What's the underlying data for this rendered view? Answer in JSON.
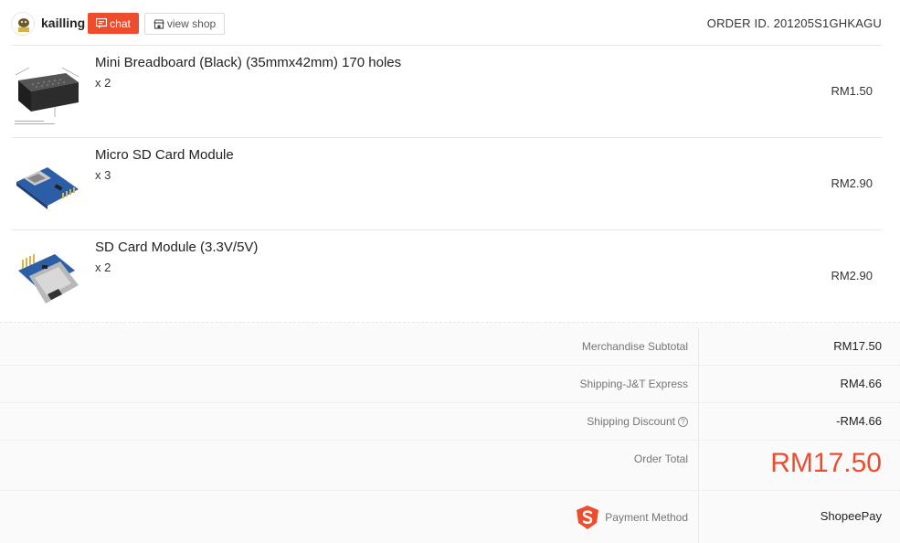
{
  "shop": {
    "name": "kailling",
    "chat_label": "chat",
    "view_shop_label": "view shop"
  },
  "order": {
    "id_label": "ORDER ID. 201205S1GHKAGU"
  },
  "items": [
    {
      "name": "Mini Breadboard (Black) (35mmx42mm) 170 holes",
      "qty": "x 2",
      "price": "RM1.50"
    },
    {
      "name": "Micro SD Card Module",
      "qty": "x 3",
      "price": "RM2.90"
    },
    {
      "name": "SD Card Module (3.3V/5V)",
      "qty": "x 2",
      "price": "RM2.90"
    }
  ],
  "summary": {
    "merchandise_subtotal_label": "Merchandise Subtotal",
    "merchandise_subtotal_value": "RM17.50",
    "shipping_label": "Shipping-J&T Express",
    "shipping_value": "RM4.66",
    "shipping_discount_label": "Shipping Discount",
    "shipping_discount_value": "-RM4.66",
    "order_total_label": "Order Total",
    "order_total_value": "RM17.50",
    "payment_method_label": "Payment Method",
    "payment_method_value": "ShopeePay"
  },
  "colors": {
    "accent": "#ee4d2d"
  },
  "icons": {
    "chat": "chat-icon",
    "shop": "shop-icon",
    "help": "help-circle-icon",
    "shopee_pay": "shopee-logo-icon"
  }
}
